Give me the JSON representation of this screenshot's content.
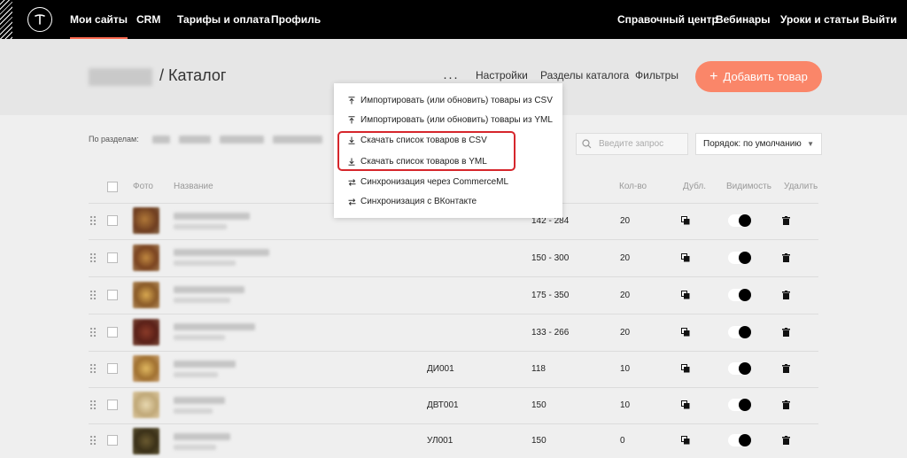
{
  "topbar": {
    "nav_left": [
      "Мои сайты",
      "CRM",
      "Тарифы и оплата",
      "Профиль"
    ],
    "nav_right": [
      "Справочный центр",
      "Вебинары",
      "Уроки и статьи",
      "Выйти"
    ]
  },
  "header": {
    "title": "/ Каталог",
    "more": "···",
    "links": [
      "Настройки",
      "Разделы каталога",
      "Фильтры"
    ],
    "add_button": "Добавить товар",
    "add_plus": "+"
  },
  "filters": {
    "label": "По разделам:",
    "search_placeholder": "Введите запрос",
    "sort_label": "Порядок: по умолчанию"
  },
  "table": {
    "columns": [
      "Фото",
      "Название",
      "Кол-во",
      "Дубл.",
      "Видимость",
      "Удалить"
    ],
    "rows": [
      {
        "sku": "",
        "price": "142 - 284",
        "qty": "20"
      },
      {
        "sku": "",
        "price": "150 - 300",
        "qty": "20"
      },
      {
        "sku": "",
        "price": "175 - 350",
        "qty": "20"
      },
      {
        "sku": "",
        "price": "133 - 266",
        "qty": "20"
      },
      {
        "sku": "ДИ001",
        "price": "118",
        "qty": "10"
      },
      {
        "sku": "ДВТ001",
        "price": "150",
        "qty": "10"
      },
      {
        "sku": "УЛ001",
        "price": "150",
        "qty": "0"
      }
    ]
  },
  "dropdown": {
    "items": [
      {
        "icon": "import-icon",
        "label": "Импортировать (или обновить) товары из CSV"
      },
      {
        "icon": "import-icon",
        "label": "Импортировать (или обновить) товары из YML"
      },
      {
        "icon": "download-icon",
        "label": "Скачать список товаров в CSV"
      },
      {
        "icon": "download-icon",
        "label": "Скачать список товаров в YML"
      },
      {
        "icon": "sync-icon",
        "label": "Синхронизация через CommerceML"
      },
      {
        "icon": "sync-icon",
        "label": "Синхронизация с ВКонтакте"
      }
    ]
  },
  "colors": {
    "accent": "#fa8669",
    "highlight": "#d6262c",
    "topbar": "#000000"
  }
}
